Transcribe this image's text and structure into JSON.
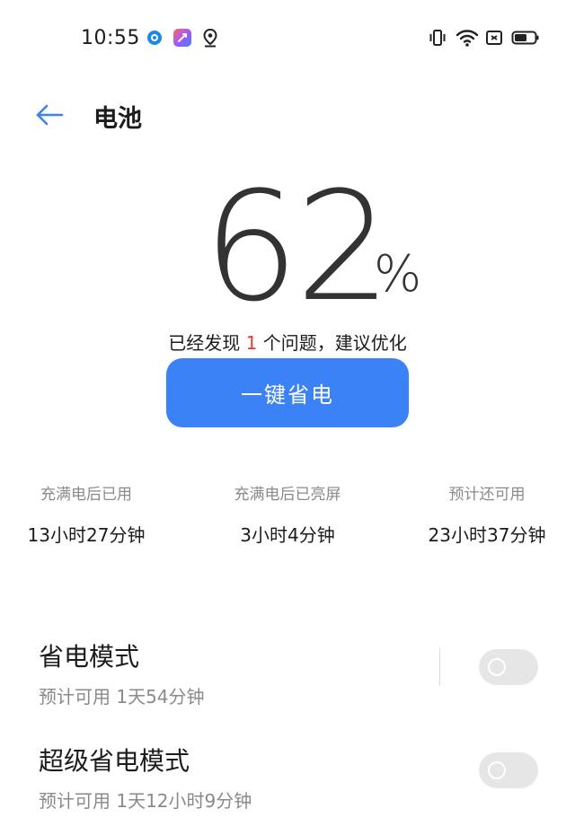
{
  "status_bar": {
    "time": "10:55",
    "left_icons": [
      "blue-dot-app-icon",
      "colorful-app-icon",
      "location-icon"
    ],
    "right_icons": [
      "vibrate-icon",
      "wifi-icon",
      "nfc-icon",
      "battery-icon"
    ],
    "battery_level": 0.62
  },
  "header": {
    "back_icon": "arrow-left-icon",
    "title": "电池"
  },
  "battery": {
    "percent": "62",
    "percent_sign": "%",
    "issue_prefix": "已经发现",
    "issue_count": "1",
    "issue_suffix": "个问题，建议优化",
    "optimize_label": "一键省电"
  },
  "stats": [
    {
      "label": "充满电后已用",
      "value": "13小时27分钟"
    },
    {
      "label": "充满电后已亮屏",
      "value": "3小时4分钟"
    },
    {
      "label": "预计还可用",
      "value": "23小时37分钟"
    }
  ],
  "modes": [
    {
      "title": "省电模式",
      "subtitle": "预计可用 1天54分钟",
      "enabled": false
    },
    {
      "title": "超级省电模式",
      "subtitle": "预计可用 1天12小时9分钟",
      "enabled": false
    }
  ],
  "colors": {
    "accent": "#3b82f6",
    "issue_highlight": "#e53935",
    "back_arrow": "#3b82f6"
  }
}
